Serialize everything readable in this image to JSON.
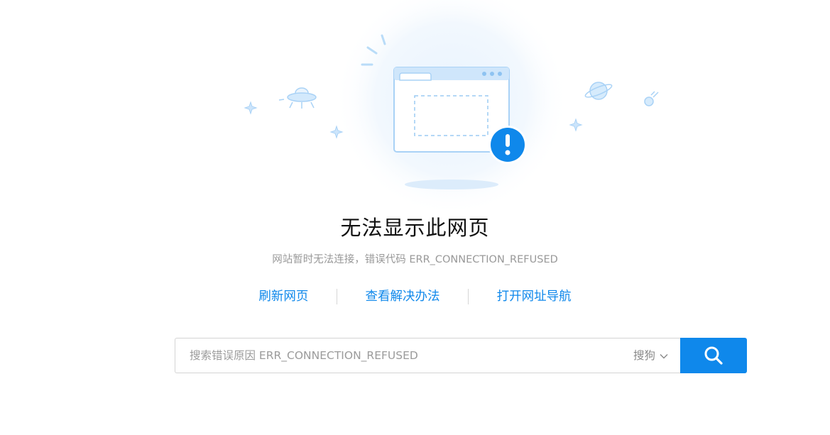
{
  "error": {
    "title": "无法显示此网页",
    "subtitle": "网站暂时无法连接，错误代码 ERR_CONNECTION_REFUSED"
  },
  "actions": {
    "refresh_label": "刷新网页",
    "solution_label": "查看解决办法",
    "nav_label": "打开网址导航"
  },
  "search": {
    "placeholder": "搜索错误原因 ERR_CONNECTION_REFUSED",
    "engine_label": "搜狗"
  },
  "icons": {
    "illustration": "browser-window-error-illustration",
    "warning": "exclamation-icon",
    "search": "search-icon",
    "dropdown": "chevron-down-icon"
  },
  "colors": {
    "accent": "#0f88eb",
    "illustration_light": "#bfe0fb",
    "text_muted": "#999999"
  }
}
